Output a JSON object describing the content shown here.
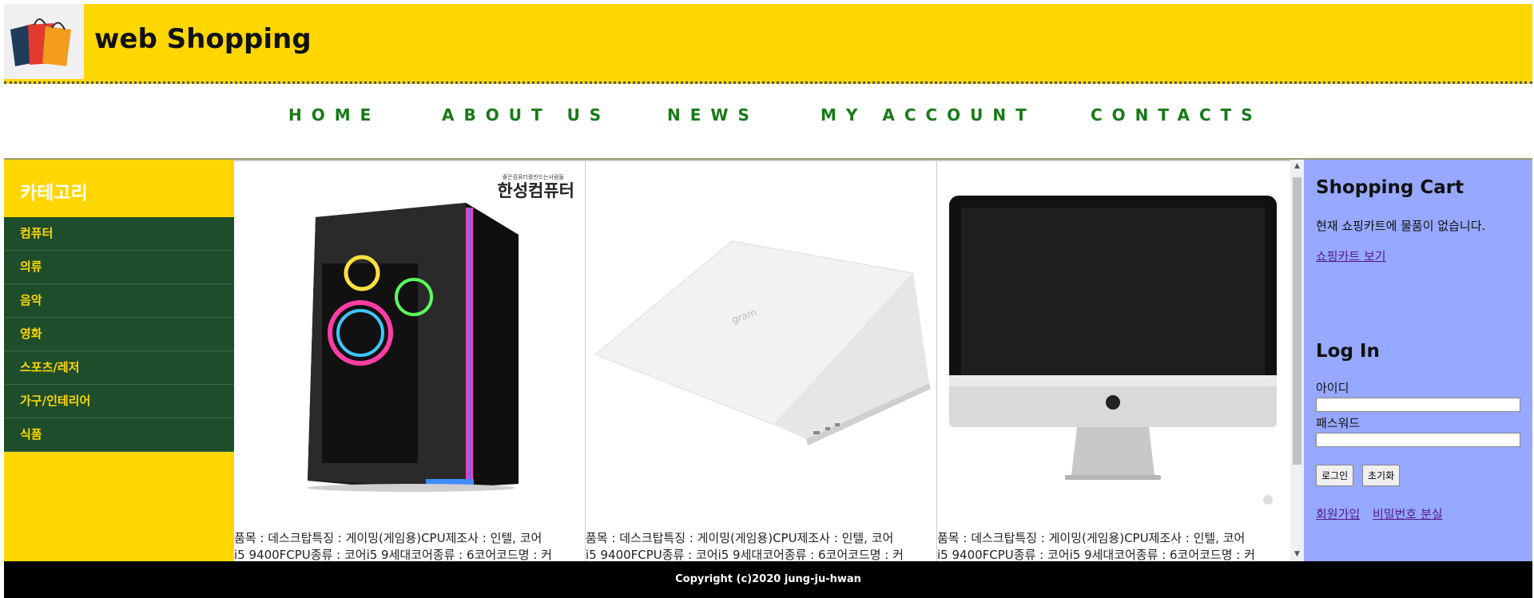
{
  "header": {
    "title": "web Shopping",
    "logo_icon": "shopping-bags-icon"
  },
  "nav": {
    "items": [
      "HOME",
      "ABOUT US",
      "NEWS",
      "MY ACCOUNT",
      "CONTACTS"
    ]
  },
  "sidebar": {
    "title": "카테고리",
    "categories": [
      "컴퓨터",
      "의류",
      "음악",
      "영화",
      "스포츠/레저",
      "가구/인테리어",
      "식품"
    ]
  },
  "products": [
    {
      "brand": "한성컴퓨터",
      "brand_tagline": "좋은컴퓨터를만드는사람들",
      "desc_line1": "품목 : 데스크탑특징 : 게이밍(게임용)CPU제조사 : 인텔, 코어",
      "desc_line2": "i5 9400FCPU종류 : 코어i5 9세대코어종류 : 6코어코드명 : 커",
      "image": "gaming-desktop-image"
    },
    {
      "brand": "gram",
      "desc_line1": "품목 : 데스크탑특징 : 게이밍(게임용)CPU제조사 : 인텔, 코어",
      "desc_line2": "i5 9400FCPU종류 : 코어i5 9세대코어종류 : 6코어코드명 : 커",
      "image": "laptop-image"
    },
    {
      "desc_line1": "품목 : 데스크탑특징 : 게이밍(게임용)CPU제조사 : 인텔, 코어",
      "desc_line2": "i5 9400FCPU종류 : 코어i5 9세대코어종류 : 6코어코드명 : 커",
      "image": "imac-image"
    }
  ],
  "cart": {
    "title": "Shopping Cart",
    "empty_text": "현재 쇼핑카트에 물품이 없습니다.",
    "view_link": "쇼핑카트 보기"
  },
  "login": {
    "title": "Log In",
    "id_label": "아이디",
    "pw_label": "패스워드",
    "login_button": "로그인",
    "reset_button": "초기화",
    "signup_link": "회원가입",
    "lost_pw_link": "비밀번호 분실"
  },
  "footer": {
    "copyright": "Copyright (c)2020 jung-ju-hwan"
  },
  "colors": {
    "header_bg": "#ffd700",
    "nav_text": "#177a17",
    "category_bg": "#1e4d2b",
    "right_panel_bg": "#96a8ff",
    "footer_bg": "#000000"
  }
}
